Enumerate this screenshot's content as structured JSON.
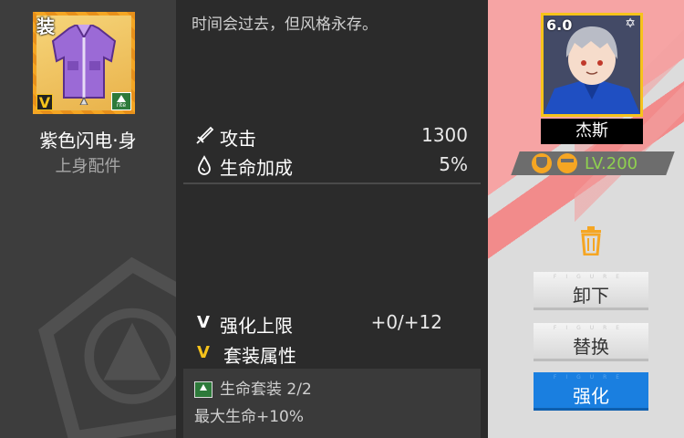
{
  "item": {
    "equip_tag": "装",
    "rarity_letter": "V",
    "brand_badge_text": "rite",
    "name": "紫色闪电·身",
    "slot": "上身配件"
  },
  "details": {
    "description": "时间会过去，但风格永存。",
    "stats": [
      {
        "label": "攻击",
        "value": "1300"
      },
      {
        "label": "生命加成",
        "value": "5%"
      }
    ],
    "enhance": {
      "label": "强化上限",
      "value": "+0/+12",
      "badge": "V"
    },
    "set_bonus": {
      "label": "套装属性",
      "badge": "V",
      "set_name": "生命套装 2/2",
      "effect": "最大生命+10%"
    }
  },
  "character": {
    "rating": "6.0",
    "star_icon": "✡",
    "name": "杰斯",
    "level": "LV.200"
  },
  "actions": {
    "unequip_label": "卸下",
    "replace_label": "替换",
    "enhance_label": "强化",
    "button_watermark": "FIGURE"
  },
  "colors": {
    "accent_blue": "#1a7fe0",
    "rarity_gold": "#f6c31b",
    "level_green": "#8fd14f",
    "trash_orange": "#f5a623"
  }
}
